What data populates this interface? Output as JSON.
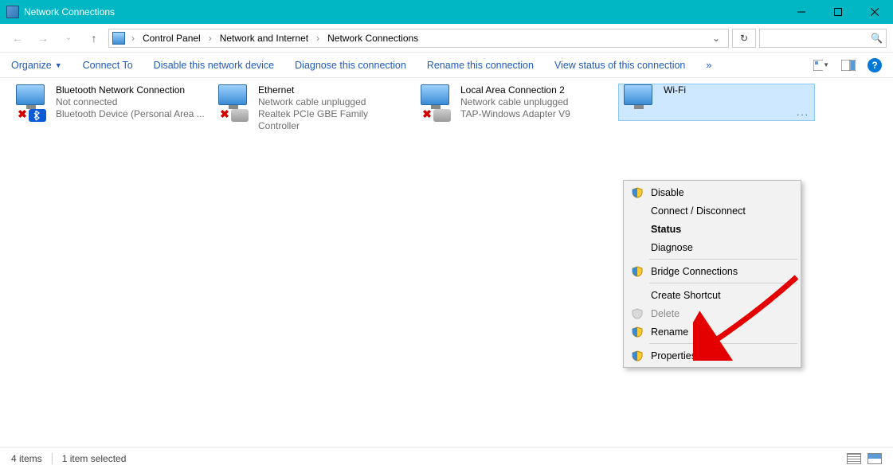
{
  "window": {
    "title": "Network Connections",
    "minimize_tip": "Minimize",
    "maximize_tip": "Maximize",
    "close_tip": "Close"
  },
  "breadcrumbs": {
    "items": [
      "Control Panel",
      "Network and Internet",
      "Network Connections"
    ]
  },
  "search": {
    "placeholder": ""
  },
  "toolbar": {
    "organize": "Organize",
    "connect_to": "Connect To",
    "disable": "Disable this network device",
    "diagnose": "Diagnose this connection",
    "rename": "Rename this connection",
    "view_status": "View status of this connection",
    "overflow": "»"
  },
  "connections": [
    {
      "name": "Bluetooth Network Connection",
      "status": "Not connected",
      "device": "Bluetooth Device (Personal Area ...",
      "kind": "bt",
      "selected": false
    },
    {
      "name": "Ethernet",
      "status": "Network cable unplugged",
      "device": "Realtek PCIe GBE Family Controller",
      "kind": "eth",
      "selected": false
    },
    {
      "name": "Local Area Connection 2",
      "status": "Network cable unplugged",
      "device": "TAP-Windows Adapter V9",
      "kind": "lac",
      "selected": false
    },
    {
      "name": "Wi-Fi",
      "status": "",
      "device": "...",
      "kind": "wifi",
      "selected": true
    }
  ],
  "context_menu": {
    "disable": "Disable",
    "connect_disconnect": "Connect / Disconnect",
    "status": "Status",
    "diagnose": "Diagnose",
    "bridge": "Bridge Connections",
    "create_shortcut": "Create Shortcut",
    "delete": "Delete",
    "rename": "Rename",
    "properties": "Properties"
  },
  "statusbar": {
    "count": "4 items",
    "selected": "1 item selected"
  },
  "colors": {
    "titlebar": "#00b7c3",
    "link": "#1e5bbd",
    "selection": "#cde8ff"
  }
}
